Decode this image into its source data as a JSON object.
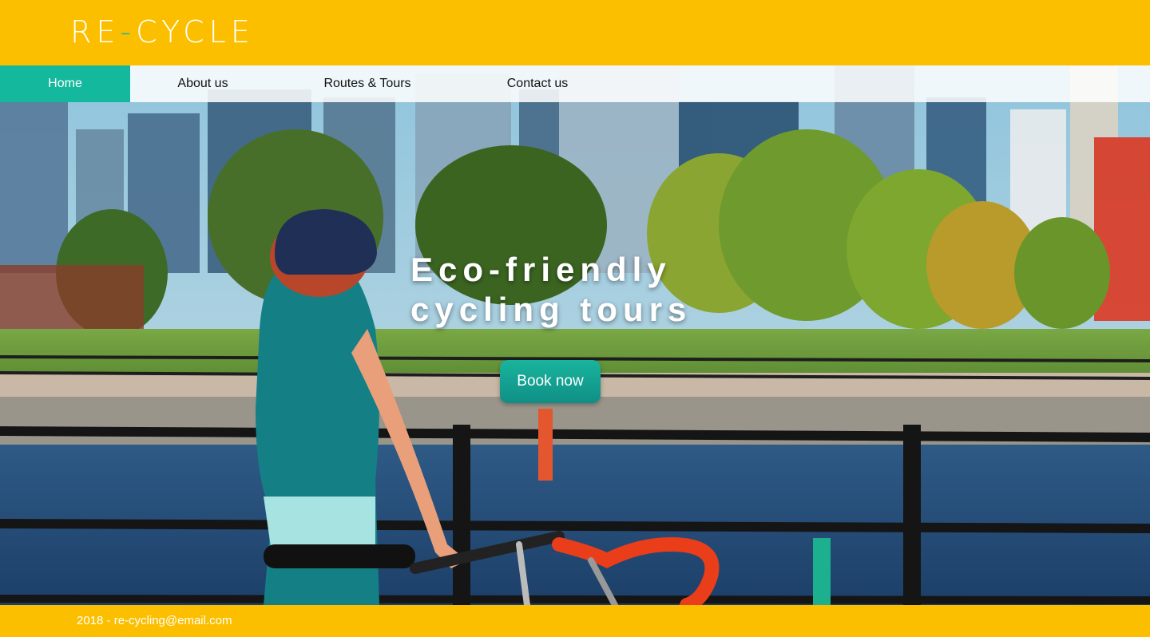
{
  "brand": {
    "logo_part1": "RE",
    "logo_dash": "-",
    "logo_part2": "CYCLE"
  },
  "nav": {
    "items": [
      {
        "label": "Home",
        "active": true
      },
      {
        "label": "About us",
        "active": false
      },
      {
        "label": "Routes & Tours",
        "active": false
      },
      {
        "label": "Contact us",
        "active": false
      }
    ]
  },
  "hero": {
    "headline_line1": "Eco-friendly",
    "headline_line2": "cycling tours",
    "cta_label": "Book now",
    "image_subject": "cyclist with helmet and road bike by a waterfront railing, city skyline behind"
  },
  "footer": {
    "text": "2018 - re-cycling@email.com"
  },
  "colors": {
    "brand_yellow": "#fbbf00",
    "accent_teal": "#14b89c",
    "text_white": "#ffffff"
  }
}
